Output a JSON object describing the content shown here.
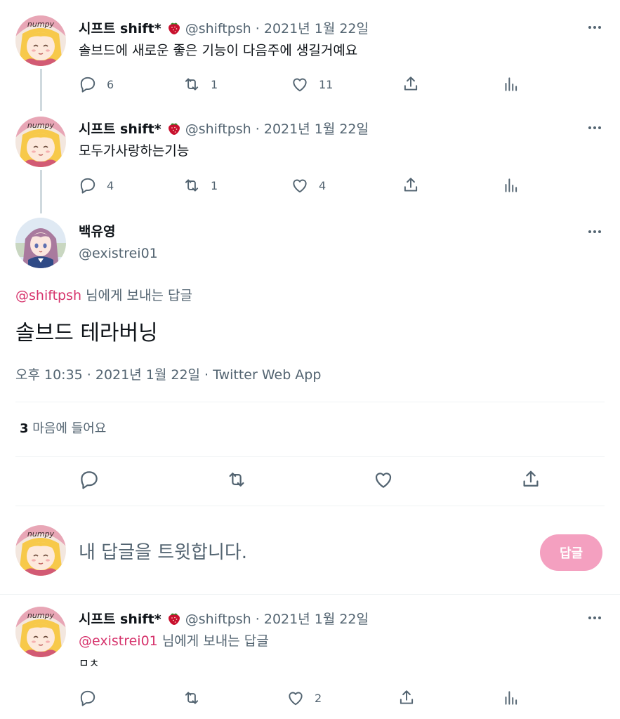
{
  "thread": [
    {
      "name": "시프트 shift*",
      "handle": "@shiftpsh",
      "date": "· 2021년 1월 22일",
      "text": "솔브드에 새로운 좋은 기능이 다음주에 생길거예요",
      "replies": "6",
      "retweets": "1",
      "likes": "11"
    },
    {
      "name": "시프트 shift*",
      "handle": "@shiftpsh",
      "date": "· 2021년 1월 22일",
      "text": "모두가사랑하는기능",
      "replies": "4",
      "retweets": "1",
      "likes": "4"
    }
  ],
  "main_tweet": {
    "name": "백유영",
    "handle": "@existrei01",
    "replying_mention": "@shiftpsh",
    "replying_suffix": "님에게 보내는 답글",
    "text": "솔브드 테라버닝",
    "timestamp": "오후 10:35 · 2021년 1월 22일 · Twitter Web App",
    "likes_count": "3",
    "likes_label": "마음에 들어요"
  },
  "composer": {
    "placeholder": "내 답글을 트윗합니다.",
    "button": "답글"
  },
  "reply": {
    "name": "시프트 shift*",
    "handle": "@shiftpsh",
    "date": "· 2021년 1월 22일",
    "mention": "@existrei01",
    "mention_suffix": "님에게 보내는 답글",
    "text": "ㅁㅊ",
    "replies": "",
    "retweets": "",
    "likes": "2"
  },
  "colors": {
    "accent": "#d6336c",
    "button": "#f4a0c0",
    "muted": "#536471"
  },
  "icons": [
    "reply-icon",
    "retweet-icon",
    "like-icon",
    "share-icon",
    "analytics-icon",
    "more-icon",
    "strawberry-emoji"
  ]
}
